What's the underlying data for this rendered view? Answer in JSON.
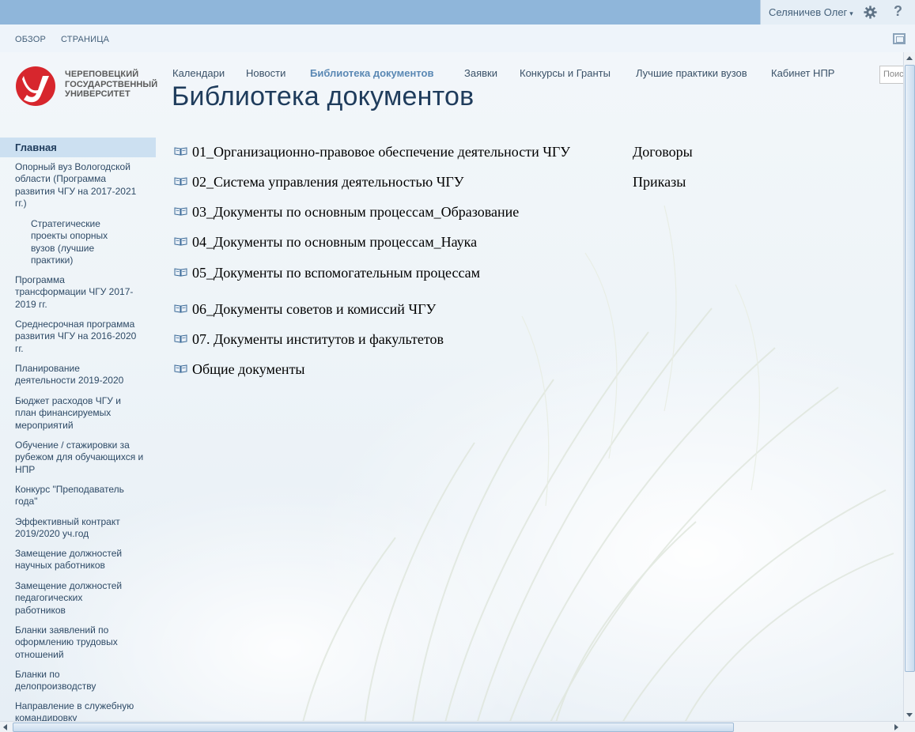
{
  "header": {
    "user_name": "Селяничев Олег",
    "user_caret": "▾",
    "help": "?"
  },
  "ribbon": {
    "tabs": [
      "ОБЗОР",
      "СТРАНИЦА"
    ]
  },
  "logo": {
    "line1": "ЧЕРЕПОВЕЦКИЙ",
    "line2": "ГОСУДАРСТВЕННЫЙ",
    "line3": "УНИВЕРСИТЕТ",
    "brand_color": "#d7262d"
  },
  "topnav": {
    "items": [
      "Календари",
      "Новости",
      "Библиотека документов",
      "Заявки",
      "Конкурсы и Гранты",
      "Лучшие практики вузов",
      "Кабинет НПР"
    ],
    "active_index": 2
  },
  "search": {
    "placeholder": "Поиск"
  },
  "page_title": "Библиотека документов",
  "leftnav": {
    "home": "Главная",
    "items": [
      "Опорный вуз Вологодской области (Программа развития ЧГУ на 2017-2021 гг.)",
      "Стратегические проекты опорных вузов (лучшие практики)",
      "Программа трансформации ЧГУ 2017-2019 гг.",
      "Среднесрочная программа развития ЧГУ на 2016-2020 гг.",
      "Планирование деятельности 2019-2020",
      "Бюджет расходов ЧГУ и план финансируемых мероприятий",
      "Обучение / стажировки за рубежом для обучающихся и НПР",
      "Конкурс \"Преподаватель года\"",
      "Эффективный контракт 2019/2020 уч.год",
      "Замещение должностей научных работников",
      "Замещение должностей педагогических работников",
      "Бланки заявлений по оформлению трудовых отношений",
      "Бланки по делопроизводству",
      "Направление в служебную командировку"
    ]
  },
  "library": {
    "folders": [
      "01_Организационно-правовое обеспечение деятельности ЧГУ",
      "02_Система управления деятельностью ЧГУ",
      "03_Документы по основным процессам_Образование",
      "04_Документы по основным процессам_Наука",
      "05_Документы по вспомогательным процессам",
      "06_Документы советов и комиссий ЧГУ",
      "07. Документы институтов и факультетов",
      "Общие документы"
    ],
    "side_links": [
      "Договоры",
      "Приказы"
    ]
  },
  "colors": {
    "topbar": "#8fb6da",
    "nav_text": "#3a5168",
    "nav_active": "#5a88b4",
    "title": "#1f3c5c",
    "home_highlight": "#cce0f1"
  }
}
